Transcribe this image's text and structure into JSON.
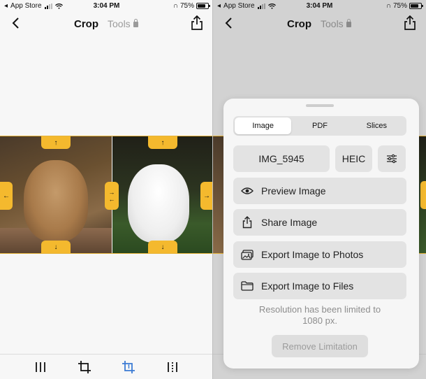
{
  "status": {
    "carrier": "App Store",
    "time": "3:04 PM",
    "battery": "75%",
    "battery_level": 0.75
  },
  "nav": {
    "title": "Crop",
    "tools_label": "Tools"
  },
  "sheet": {
    "tabs": [
      {
        "label": "Image",
        "active": true
      },
      {
        "label": "PDF",
        "active": false
      },
      {
        "label": "Slices",
        "active": false
      }
    ],
    "filename": "IMG_5945",
    "format": "HEIC",
    "actions": [
      {
        "label": "Preview Image",
        "icon": "eye-icon"
      },
      {
        "label": "Share Image",
        "icon": "share-icon"
      },
      {
        "label": "Export Image to Photos",
        "icon": "photos-icon"
      },
      {
        "label": "Export Image to Files",
        "icon": "folder-icon"
      }
    ],
    "note_line1": "Resolution has been limited to",
    "note_line2": "1080 px.",
    "remove_label": "Remove Limitation"
  },
  "colors": {
    "accent_handle": "#f4b92e",
    "active_tool": "#3b7bd4"
  }
}
